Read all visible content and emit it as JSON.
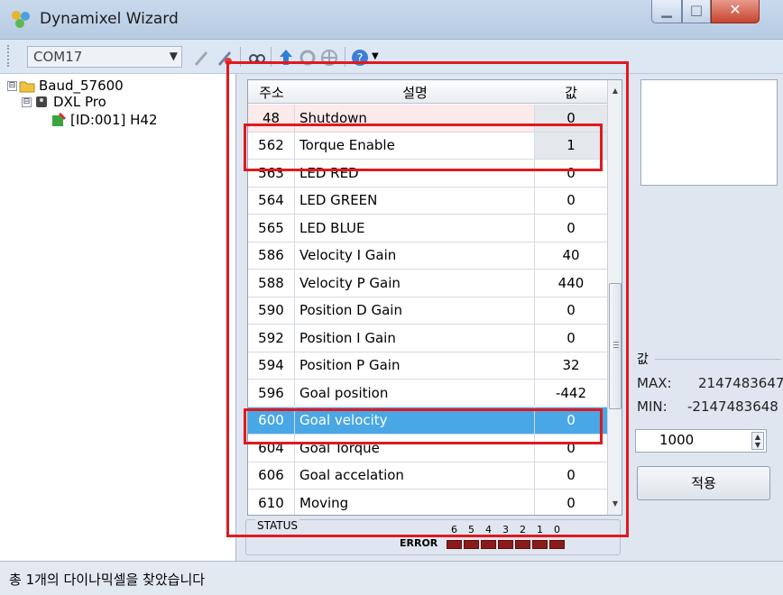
{
  "window": {
    "title": "Dynamixel Wizard",
    "minimize_glyph": "▁",
    "maximize_glyph": "□",
    "close_glyph": "✕"
  },
  "toolbar": {
    "port_value": "COM17",
    "icons": [
      "connect-icon",
      "disconnect-icon",
      "search-icon",
      "upload-icon",
      "refresh-icon",
      "target-icon",
      "help-icon"
    ]
  },
  "tree": {
    "root": "Baud_57600",
    "model": "DXL Pro",
    "device": "[ID:001] H42",
    "expanders": [
      "⊟",
      "⊟"
    ]
  },
  "grid": {
    "columns": {
      "addr": "주소",
      "desc": "설명",
      "value": "값"
    },
    "rows": [
      {
        "addr": "48",
        "desc": "Shutdown",
        "value": "0"
      },
      {
        "addr": "562",
        "desc": "Torque Enable",
        "value": "1"
      },
      {
        "addr": "563",
        "desc": "LED RED",
        "value": "0"
      },
      {
        "addr": "564",
        "desc": "LED GREEN",
        "value": "0"
      },
      {
        "addr": "565",
        "desc": "LED BLUE",
        "value": "0"
      },
      {
        "addr": "586",
        "desc": "Velocity I Gain",
        "value": "40"
      },
      {
        "addr": "588",
        "desc": "Velocity P Gain",
        "value": "440"
      },
      {
        "addr": "590",
        "desc": "Position D Gain",
        "value": "0"
      },
      {
        "addr": "592",
        "desc": "Position I Gain",
        "value": "0"
      },
      {
        "addr": "594",
        "desc": "Position P Gain",
        "value": "32"
      },
      {
        "addr": "596",
        "desc": "Goal position",
        "value": "-442"
      },
      {
        "addr": "600",
        "desc": "Goal velocity",
        "value": "0"
      },
      {
        "addr": "604",
        "desc": "Goal Torque",
        "value": "0"
      },
      {
        "addr": "606",
        "desc": "Goal accelation",
        "value": "0"
      },
      {
        "addr": "610",
        "desc": "Moving",
        "value": "0"
      }
    ],
    "selected_addr": "600",
    "highlight_color": "#4aa7e6",
    "scroll_up": "▲",
    "scroll_down": "▼"
  },
  "status": {
    "label": "STATUS",
    "error_label": "ERROR",
    "bits": [
      "6",
      "5",
      "4",
      "3",
      "2",
      "1",
      "0"
    ],
    "led_color": "#8b1b1b"
  },
  "value_panel": {
    "label": "값",
    "max_label": "MAX:",
    "max_value": "2147483647",
    "min_label": "MIN:",
    "min_value": "-2147483648",
    "input_value": "1000",
    "spin_up": "▲",
    "spin_down": "▼",
    "apply_label": "적용"
  },
  "statusbar": {
    "message": "총 1개의 다이나믹셀을 찾았습니다"
  },
  "annotation_color": "#e0191f"
}
